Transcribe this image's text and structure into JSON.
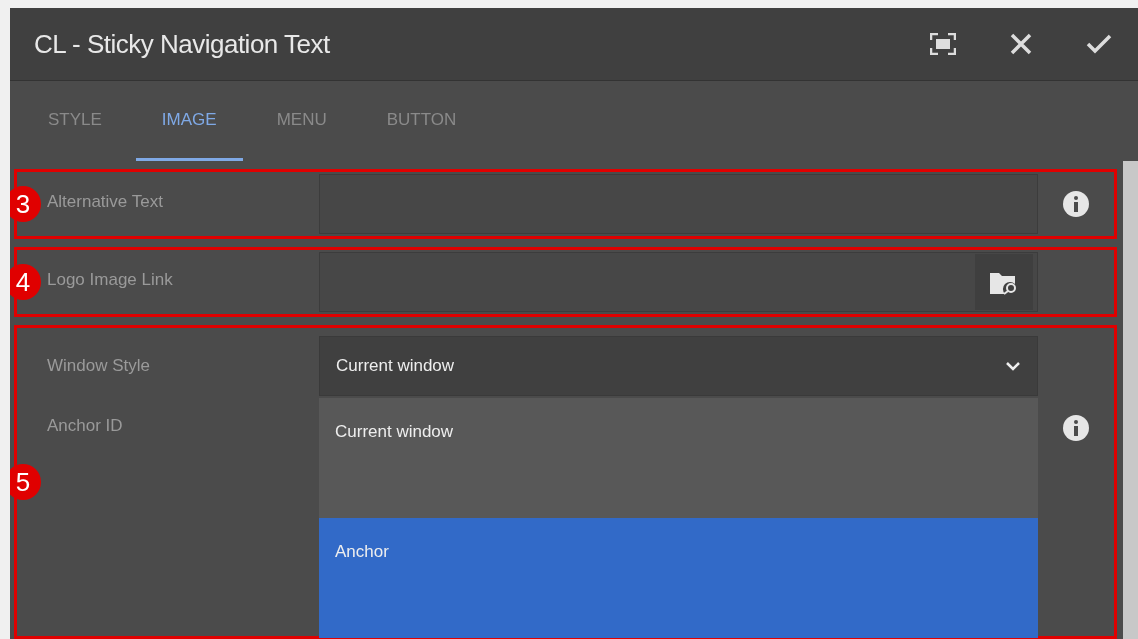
{
  "dialog": {
    "title": "CL - Sticky Navigation Text"
  },
  "tabs": [
    {
      "label": "STYLE",
      "selected": false
    },
    {
      "label": "IMAGE",
      "selected": true
    },
    {
      "label": "MENU",
      "selected": false
    },
    {
      "label": "BUTTON",
      "selected": false
    }
  ],
  "sections": [
    {
      "callout": "3",
      "fields": [
        {
          "kind": "text",
          "label": "Alternative Text",
          "info": true
        }
      ]
    },
    {
      "callout": "4",
      "fields": [
        {
          "kind": "path",
          "label": "Logo Image Link",
          "info": false
        }
      ]
    },
    {
      "callout": "5",
      "fields": [
        {
          "kind": "select",
          "label": "Window Style",
          "value": "Current window",
          "info": false,
          "options": [
            {
              "label": "Current window",
              "highlighted": false
            },
            {
              "label": "Anchor",
              "highlighted": true
            }
          ]
        },
        {
          "kind": "text-hidden",
          "label": "Anchor ID",
          "info": true
        }
      ]
    }
  ]
}
